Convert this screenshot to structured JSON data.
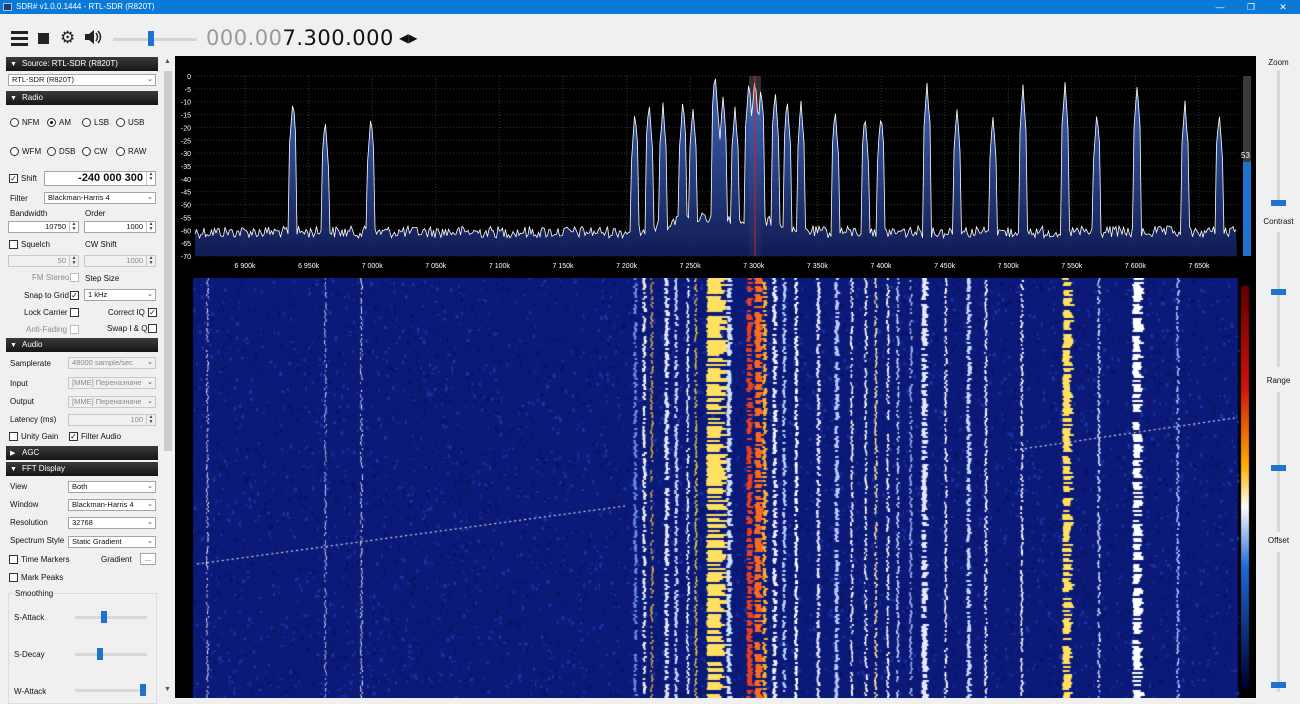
{
  "window": {
    "title": "SDR# v1.0.0.1444 - RTL-SDR (R820T)"
  },
  "toolbar": {
    "frequency_dim": "000.00",
    "frequency_bright": "7.300.000"
  },
  "source": {
    "header": "Source: RTL-SDR (R820T)",
    "device": "RTL-SDR (R820T)"
  },
  "radio": {
    "header": "Radio",
    "modes_row1": [
      "NFM",
      "AM",
      "LSB",
      "USB"
    ],
    "modes_row2": [
      "WFM",
      "DSB",
      "CW",
      "RAW"
    ],
    "selected_mode": "AM",
    "shift_label": "Shift",
    "shift_value": "-240 000 300",
    "filter_label": "Filter",
    "filter_value": "Blackman-Harris 4",
    "bandwidth_label": "Bandwidth",
    "bandwidth_value": "10750",
    "order_label": "Order",
    "order_value": "1000",
    "squelch_label": "Squelch",
    "squelch_value": "50",
    "cwshift_label": "CW Shift",
    "cwshift_value": "1000",
    "fmstereo_label": "FM Stereo",
    "stepsize_label": "Step Size",
    "snap_label": "Snap to Grid",
    "stepsize_value": "1 kHz",
    "lockcarrier_label": "Lock Carrier",
    "correctiq_label": "Correct IQ",
    "antifading_label": "Anti-Fading",
    "swapiq_label": "Swap I & Q"
  },
  "audio": {
    "header": "Audio",
    "samplerate_label": "Samplerate",
    "samplerate_value": "48000 sample/sec",
    "input_label": "Input",
    "input_value": "[MME] Переназначе",
    "output_label": "Output",
    "output_value": "[MME] Переназначе",
    "latency_label": "Latency (ms)",
    "latency_value": "100",
    "unitygain_label": "Unity Gain",
    "filteraudio_label": "Filter Audio"
  },
  "agc": {
    "header": "AGC"
  },
  "fft": {
    "header": "FFT Display",
    "view_label": "View",
    "view_value": "Both",
    "window_label": "Window",
    "window_value": "Blackman-Harris 4",
    "resolution_label": "Resolution",
    "resolution_value": "32768",
    "style_label": "Spectrum Style",
    "style_value": "Static Gradient",
    "timemarkers_label": "Time Markers",
    "gradient_label": "Gradient",
    "gradient_btn": "...",
    "markpeaks_label": "Mark Peaks",
    "smoothing_label": "Smoothing",
    "sattack_label": "S-Attack",
    "sdecay_label": "S-Decay",
    "wattack_label": "W-Attack"
  },
  "right": {
    "zoom": "Zoom",
    "contrast": "Contrast",
    "range": "Range",
    "offset": "Offset"
  },
  "spectrum": {
    "db_ticks": [
      "0",
      "-5",
      "-10",
      "-15",
      "-20",
      "-25",
      "-30",
      "-35",
      "-40",
      "-45",
      "-50",
      "-55",
      "-60",
      "-65",
      "-70"
    ],
    "freq_ticks": [
      "6 900k",
      "6 950k",
      "7 000k",
      "7 050k",
      "7 100k",
      "7 150k",
      "7 200k",
      "7 250k",
      "7 300k",
      "7 350k",
      "7 400k",
      "7 450k",
      "7 500k",
      "7 550k",
      "7 600k",
      "7 650k"
    ],
    "level_value": "53"
  },
  "colors": {
    "accent": "#1e72d0",
    "title_bar": "#0b79d8",
    "spectrum_fill": "#2a3f8c",
    "waterfall_bg": "#0b1a78"
  }
}
